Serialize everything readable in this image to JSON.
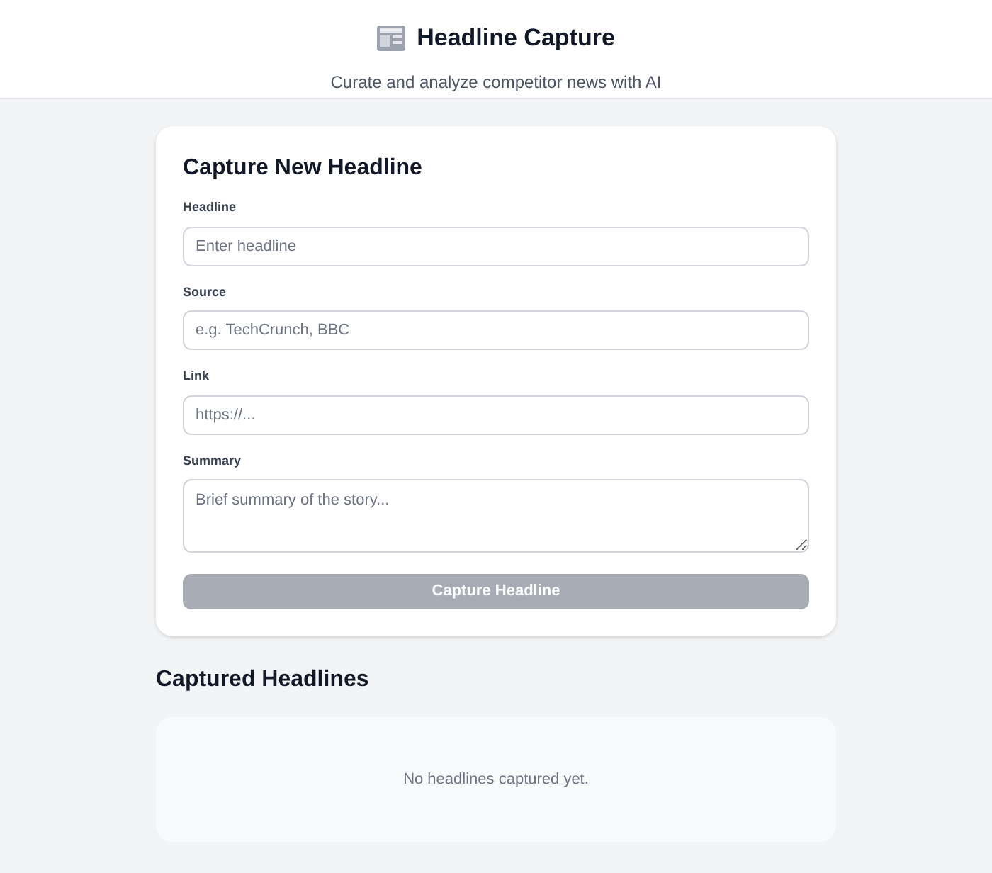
{
  "header": {
    "title": "Headline Capture",
    "subtitle": "Curate and analyze competitor news with AI"
  },
  "form": {
    "title": "Capture New Headline",
    "fields": [
      {
        "label": "Headline",
        "placeholder": "Enter headline",
        "kind": "input"
      },
      {
        "label": "Source",
        "placeholder": "e.g. TechCrunch, BBC",
        "kind": "input"
      },
      {
        "label": "Link",
        "placeholder": "https://...",
        "kind": "input"
      },
      {
        "label": "Summary",
        "placeholder": "Brief summary of the story...",
        "kind": "textarea"
      }
    ],
    "submit": {
      "label": "Capture Headline",
      "disabled": true
    }
  },
  "captured": {
    "title": "Captured Headlines",
    "empty_message": "No headlines captured yet."
  }
}
